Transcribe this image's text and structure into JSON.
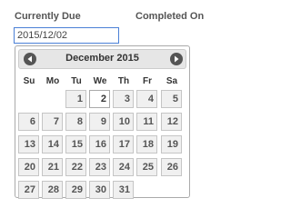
{
  "labels": {
    "currently_due": "Currently Due",
    "completed_on": "Completed On"
  },
  "date_input": {
    "value": "2015/12/02"
  },
  "datepicker": {
    "month_title": "December 2015",
    "prev_icon": "chevron-left-icon",
    "next_icon": "chevron-right-icon",
    "weekdays": [
      "Su",
      "Mo",
      "Tu",
      "We",
      "Th",
      "Fr",
      "Sa"
    ],
    "first_weekday_index": 2,
    "days": [
      "1",
      "2",
      "3",
      "4",
      "5",
      "6",
      "7",
      "8",
      "9",
      "10",
      "11",
      "12",
      "13",
      "14",
      "15",
      "16",
      "17",
      "18",
      "19",
      "20",
      "21",
      "22",
      "23",
      "24",
      "25",
      "26",
      "27",
      "28",
      "29",
      "30",
      "31"
    ],
    "highlighted_day": "2"
  }
}
